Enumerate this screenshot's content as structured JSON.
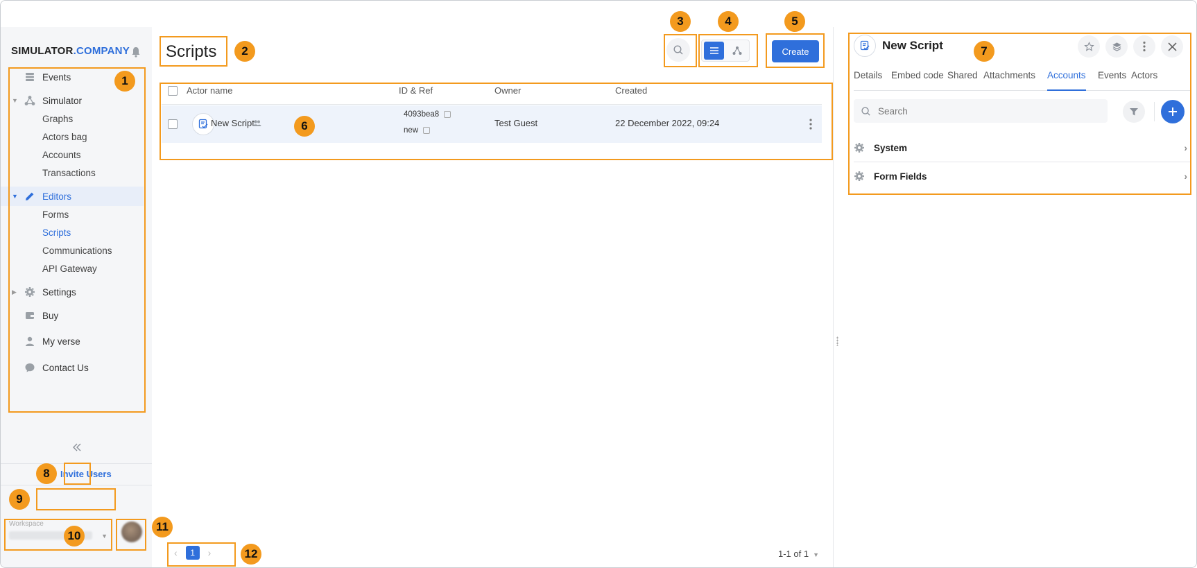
{
  "brand": {
    "part1": "SIMULATOR",
    "part2": ".COMPANY"
  },
  "sidebar": {
    "items": [
      {
        "label": "Events",
        "icon": "events-icon"
      },
      {
        "label": "Simulator",
        "icon": "simulator-icon"
      },
      {
        "label": "Graphs"
      },
      {
        "label": "Actors bag"
      },
      {
        "label": "Accounts"
      },
      {
        "label": "Transactions"
      },
      {
        "label": "Editors",
        "icon": "pencil-icon"
      },
      {
        "label": "Forms"
      },
      {
        "label": "Scripts"
      },
      {
        "label": "Communications"
      },
      {
        "label": "API Gateway"
      },
      {
        "label": "Settings",
        "icon": "gear-icon"
      },
      {
        "label": "Buy",
        "icon": "wallet-icon"
      },
      {
        "label": "My verse",
        "icon": "user-icon"
      },
      {
        "label": "Contact Us",
        "icon": "chat-icon"
      }
    ],
    "invite_label": "Invite Users",
    "workspace_label": "Workspace"
  },
  "main": {
    "title": "Scripts",
    "create_label": "Create",
    "columns": [
      "Actor name",
      "ID & Ref",
      "Owner",
      "Created"
    ],
    "rows": [
      {
        "name": "New Script",
        "id": "4093bea8",
        "ref": "new",
        "owner": "Test Guest",
        "created": "22 December 2022, 09:24"
      }
    ],
    "pagination": {
      "current": "1",
      "info": "1-1 of 1"
    }
  },
  "panel": {
    "title": "New Script",
    "tabs": [
      "Details",
      "Embed code",
      "Shared",
      "Attachments",
      "Accounts",
      "Events",
      "Actors"
    ],
    "active_tab": "Accounts",
    "search_placeholder": "Search",
    "accounts": [
      "System",
      "Form Fields"
    ]
  },
  "annotations": [
    "1",
    "2",
    "3",
    "4",
    "5",
    "6",
    "7",
    "8",
    "9",
    "10",
    "11",
    "12"
  ],
  "colors": {
    "accent": "#2f6fdb",
    "annotation": "#f39a1e",
    "sidebar_bg": "#f5f6f8",
    "row_highlight": "#eef3fb"
  }
}
